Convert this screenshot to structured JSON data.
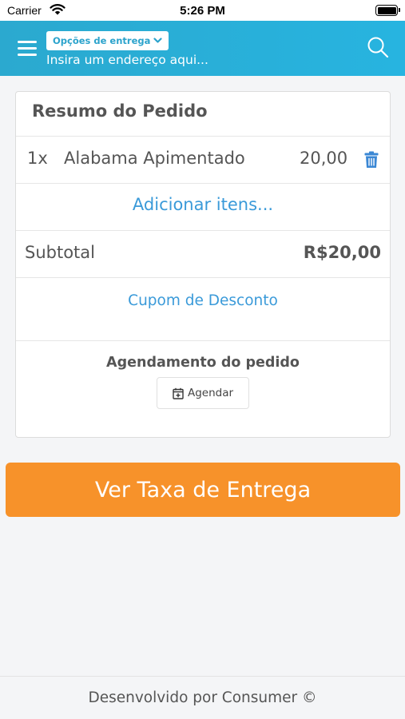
{
  "status_bar": {
    "carrier": "Carrier",
    "time": "5:26 PM"
  },
  "header": {
    "delivery_options_label": "Opções de entrega",
    "address_placeholder": "Insira um endereço aqui...",
    "accent_color": "#2ba9cf"
  },
  "order_summary": {
    "title": "Resumo do Pedido",
    "items": [
      {
        "quantity": "1x",
        "name": "Alabama Apimentado",
        "price": "20,00"
      }
    ],
    "add_items_label": "Adicionar itens...",
    "subtotal_label": "Subtotal",
    "subtotal_value": "R$20,00",
    "coupon_label": "Cupom de Desconto",
    "schedule_title": "Agendamento do pedido",
    "schedule_button_label": "Agendar"
  },
  "cta": {
    "label": "Ver Taxa de Entrega",
    "color": "#f7922a"
  },
  "footer": {
    "text": "Desenvolvido por Consumer ©"
  },
  "icons": [
    "wifi-icon",
    "battery-icon",
    "menu-icon",
    "chevron-down-icon",
    "search-icon",
    "trash-icon",
    "calendar-plus-icon"
  ]
}
